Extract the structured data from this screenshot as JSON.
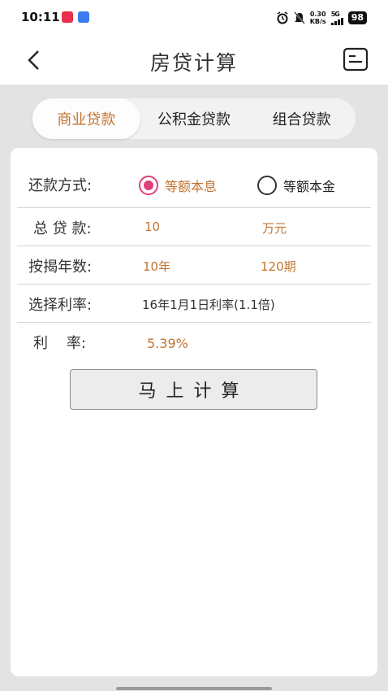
{
  "status_bar": {
    "time": "10:11",
    "net_speed_value": "0.30",
    "net_speed_unit": "KB/s",
    "network": "5G",
    "battery": "98"
  },
  "header": {
    "title": "房贷计算"
  },
  "tabs": [
    {
      "label": "商业贷款",
      "active": true
    },
    {
      "label": "公积金贷款",
      "active": false
    },
    {
      "label": "组合贷款",
      "active": false
    }
  ],
  "form": {
    "repayment": {
      "label": "还款方式:",
      "options": [
        {
          "label": "等额本息",
          "selected": true
        },
        {
          "label": "等额本金",
          "selected": false
        }
      ]
    },
    "total_loan": {
      "label": "总 贷 款:",
      "value": "10",
      "unit": "万元"
    },
    "years": {
      "label": "按揭年数:",
      "value": "10年",
      "periods": "120期"
    },
    "rate_select": {
      "label": "选择利率:",
      "value": "16年1月1日利率(1.1倍)"
    },
    "rate": {
      "label": "利    率:",
      "value": "5.39%"
    }
  },
  "calc_button": "马上计算",
  "colors": {
    "accent": "#c27430",
    "radio_selected": "#e0407a",
    "background": "#e3e3e3"
  }
}
